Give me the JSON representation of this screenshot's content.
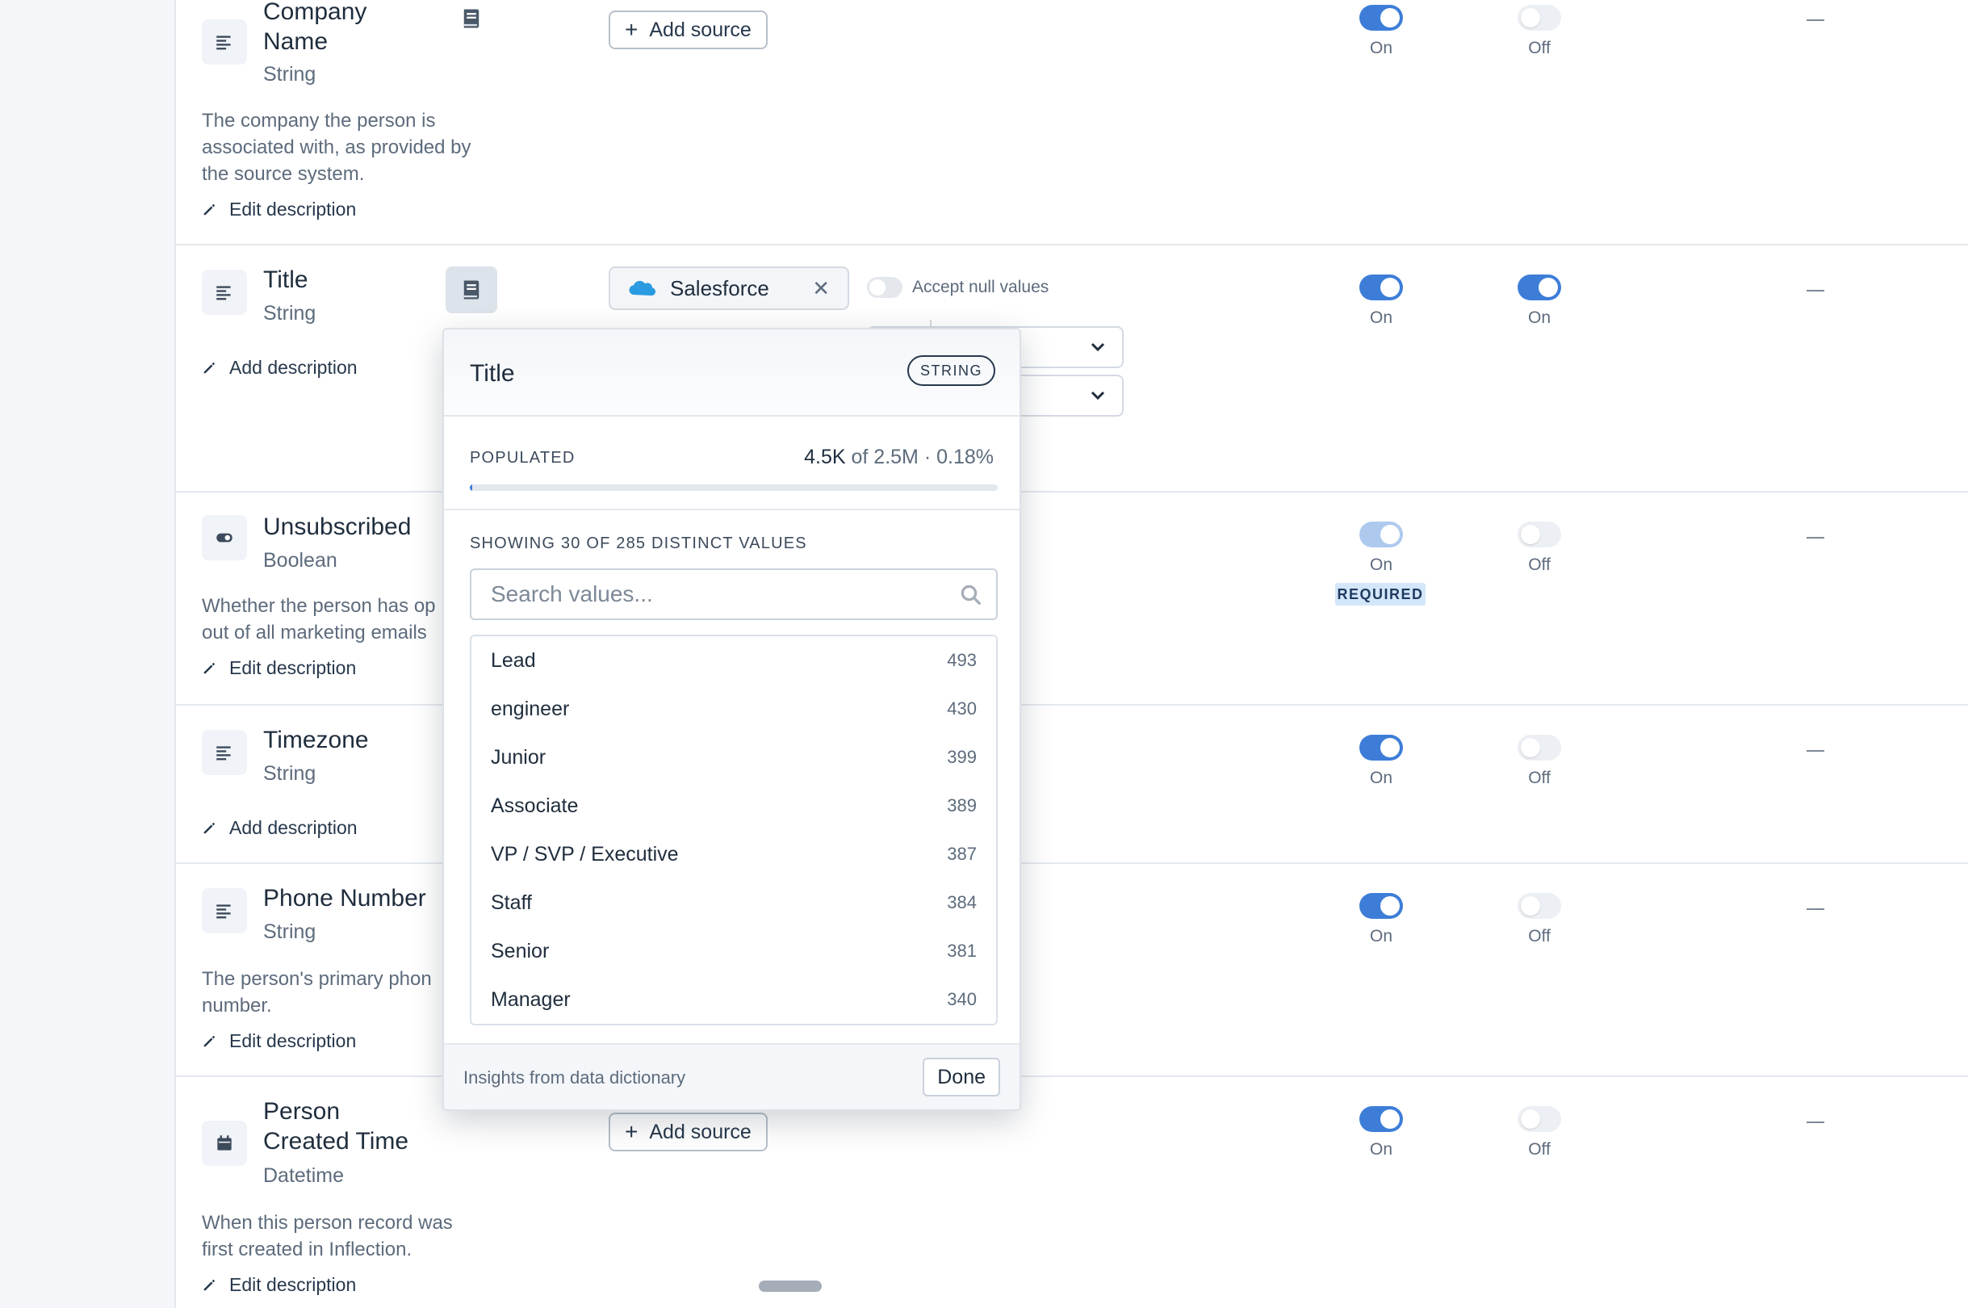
{
  "rows": {
    "company": {
      "name_line1": "Company",
      "name_line2": "Name",
      "type": "String",
      "desc_line1": "The company the person is",
      "desc_line2": "associated with, as provided by",
      "desc_line3": "the source system.",
      "edit_label": "Edit description",
      "add_source_label": "Add source",
      "toggle1_label": "On",
      "toggle2_label": "Off"
    },
    "title": {
      "name": "Title",
      "type": "String",
      "add_desc_label": "Add description",
      "source_name": "Salesforce",
      "accept_null_label": "Accept null values",
      "toggle1_label": "On",
      "toggle2_label": "On"
    },
    "unsubscribed": {
      "name": "Unsubscribed",
      "type": "Boolean",
      "desc_line1": "Whether the person has op",
      "desc_line2": "out of all marketing emails",
      "edit_label": "Edit description",
      "toggle1_label": "On",
      "toggle2_label": "Off",
      "required_label": "REQUIRED"
    },
    "timezone": {
      "name": "Timezone",
      "type": "String",
      "add_desc_label": "Add description",
      "toggle1_label": "On",
      "toggle2_label": "Off"
    },
    "phone": {
      "name": "Phone Number",
      "type": "String",
      "desc_line1": "The person's primary phon",
      "desc_line2": "number.",
      "edit_label": "Edit description",
      "toggle1_label": "On",
      "toggle2_label": "Off"
    },
    "created": {
      "name_line1": "Person",
      "name_line2": "Created Time",
      "type": "Datetime",
      "desc_line1": "When this person record was",
      "desc_line2": "first created in Inflection.",
      "edit_label": "Edit description",
      "add_source_label": "Add source",
      "toggle1_label": "On",
      "toggle2_label": "Off"
    }
  },
  "popover": {
    "title": "Title",
    "type_badge": "STRING",
    "populated_label": "POPULATED",
    "populated_count": "4.5K",
    "populated_of": "of 2.5M",
    "populated_pct": "· 0.18%",
    "populated_fraction": 0.0018,
    "distinct_label": "SHOWING 30 OF 285 DISTINCT VALUES",
    "search_placeholder": "Search values...",
    "values": [
      {
        "label": "Lead",
        "count": "493"
      },
      {
        "label": "engineer",
        "count": "430"
      },
      {
        "label": "Junior",
        "count": "399"
      },
      {
        "label": "Associate",
        "count": "389"
      },
      {
        "label": "VP / SVP / Executive",
        "count": "387"
      },
      {
        "label": "Staff",
        "count": "384"
      },
      {
        "label": "Senior",
        "count": "381"
      },
      {
        "label": "Manager",
        "count": "340"
      }
    ],
    "footer_text": "Insights from data dictionary",
    "done_label": "Done"
  },
  "colors": {
    "accent": "#3d7dd8",
    "toggle_off": "#eceff3",
    "required_bg": "#d4e6f9"
  }
}
